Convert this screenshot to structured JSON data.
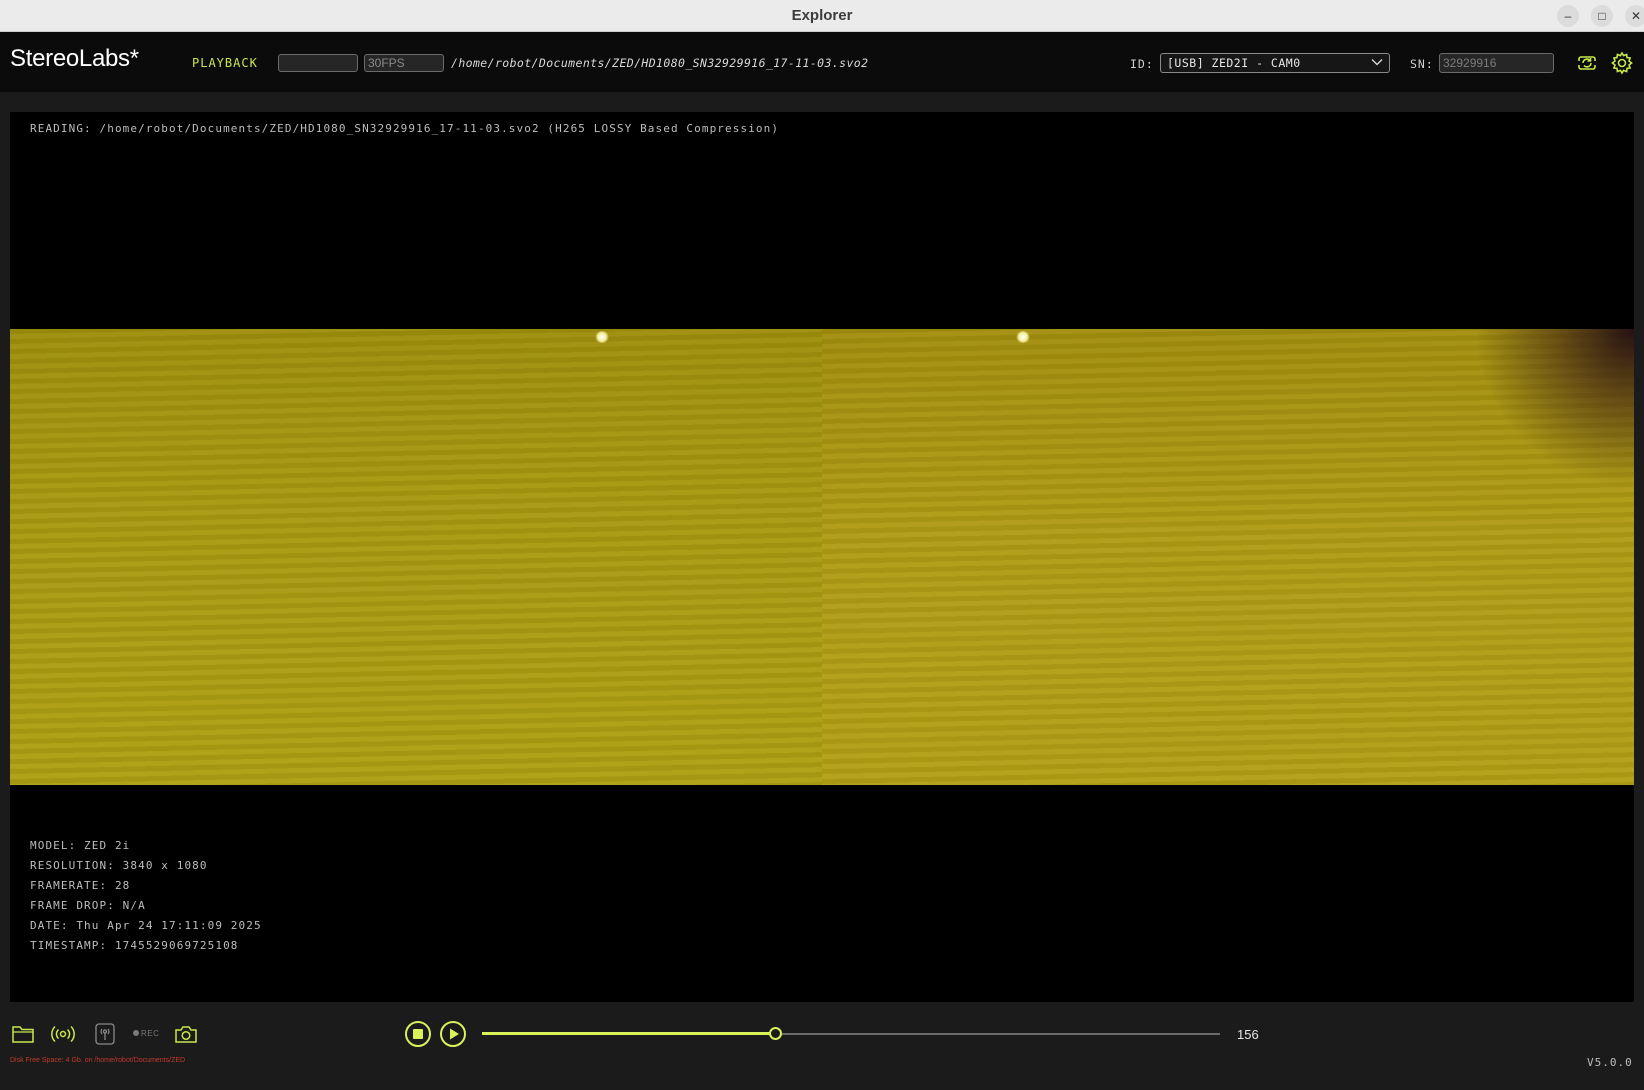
{
  "window": {
    "title": "Explorer",
    "controls": {
      "minimize": "–",
      "maximize": "□",
      "close": "✕"
    }
  },
  "header": {
    "brand": "StereoLabs*",
    "mode": "PLAYBACK",
    "blank_field": "",
    "fps_placeholder": "30FPS",
    "file_path": "/home/robot/Documents/ZED/HD1080_SN32929916_17-11-03.svo2",
    "id_label": "ID:",
    "camera_select": "[USB] ZED2I - CAM0",
    "sn_label": "SN:",
    "serial_number": "32929916",
    "icons": {
      "refresh": "refresh-icon",
      "settings": "gear-icon",
      "dropdown": "chevron-down-icon"
    }
  },
  "viewer": {
    "reading": "READING: /home/robot/Documents/ZED/HD1080_SN32929916_17-11-03.svo2 (H265 LOSSY Based Compression)",
    "info": {
      "model": "MODEL: ZED 2i",
      "resolution": "RESOLUTION: 3840 x 1080",
      "framerate": "FRAMERATE: 28",
      "frame_drop": "FRAME DROP: N/A",
      "date": "DATE: Thu Apr 24 17:11:09 2025",
      "timestamp": "TIMESTAMP: 1745529069725108"
    }
  },
  "toolbar": {
    "icons": [
      "folder-icon",
      "stream-icon",
      "broadcast-icon",
      "rec-icon",
      "camera-icon",
      "stop-icon",
      "play-icon"
    ],
    "rec_label": "REC",
    "frame_number": "156",
    "progress": 0.397,
    "accent_color": "#d9f25a"
  },
  "footer": {
    "disk_space": "Disk Free Space: 4 Gb. on /home/robot/Documents/ZED",
    "version": "V5.0.0"
  }
}
